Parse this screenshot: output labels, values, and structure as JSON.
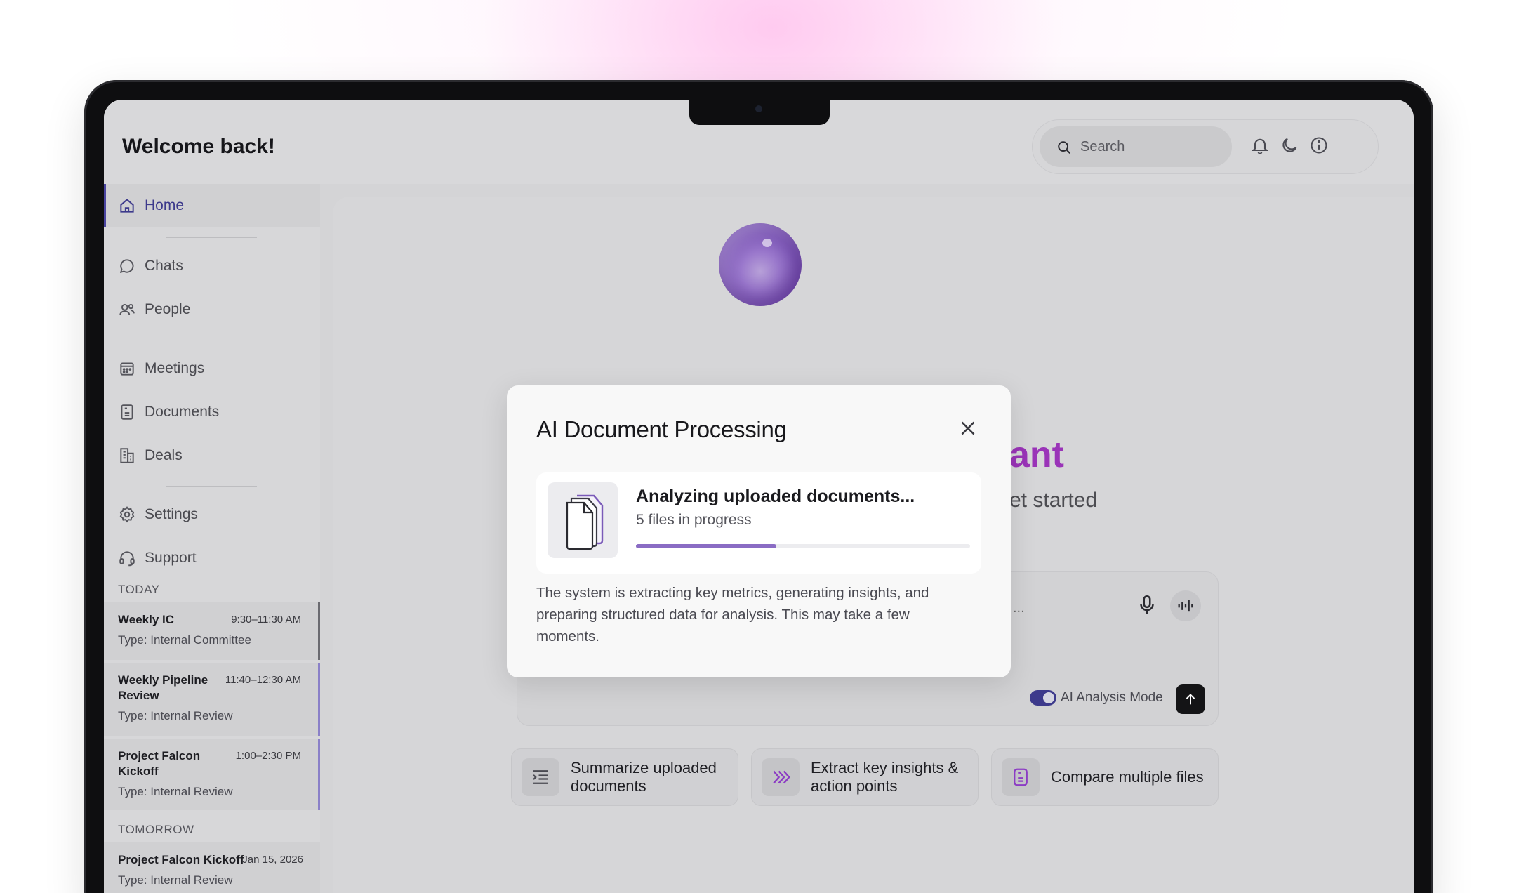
{
  "header": {
    "title": "Welcome back!",
    "search_placeholder": "Search"
  },
  "sidebar": {
    "items": [
      {
        "label": "Home",
        "icon": "home-icon",
        "active": true
      },
      {
        "label": "Chats",
        "icon": "chat-icon"
      },
      {
        "label": "People",
        "icon": "people-icon"
      },
      {
        "label": "Meetings",
        "icon": "calendar-icon"
      },
      {
        "label": "Documents",
        "icon": "document-icon"
      },
      {
        "label": "Deals",
        "icon": "building-icon"
      },
      {
        "label": "Settings",
        "icon": "gear-icon"
      },
      {
        "label": "Support",
        "icon": "headset-icon"
      }
    ],
    "today_label": "TODAY",
    "tomorrow_label": "TOMORROW",
    "meetings_today": [
      {
        "title": "Weekly IC",
        "time": "9:30–11:30 AM",
        "type": "Type: Internal Committee"
      },
      {
        "title": "Weekly Pipeline Review",
        "time": "11:40–12:30 AM",
        "type": "Type: Internal Review"
      },
      {
        "title": "Project Falcon Kickoff",
        "time": "1:00–2:30 PM",
        "type": "Type: Internal Review"
      }
    ],
    "meetings_tomorrow": [
      {
        "title": "Project Falcon Kickoff",
        "time": "Jan 15, 2026",
        "type": "Type: Internal Review"
      }
    ]
  },
  "main": {
    "hero_title_partial": "ant",
    "hero_sub_partial": "et started",
    "prompt_placeholder_partial": "...",
    "ai_mode_label": "AI Analysis Mode",
    "ai_mode_on": true,
    "suggestions": [
      {
        "label": "Summarize uploaded documents",
        "icon": "list-indent-icon"
      },
      {
        "label": "Extract key insights & action points",
        "icon": "chevrons-insight-icon"
      },
      {
        "label": "Compare multiple files",
        "icon": "file-compare-icon"
      }
    ]
  },
  "modal": {
    "title": "AI Document Processing",
    "status_title": "Analyzing uploaded documents...",
    "status_sub": "5 files in progress",
    "progress": 0.42,
    "description": "The system is extracting key metrics, generating insights, and preparing structured data for analysis. This may take a few moments."
  },
  "colors": {
    "accent": "#3d3a8c",
    "progress": "#8a6cc4",
    "hero": "#9a34b8"
  }
}
